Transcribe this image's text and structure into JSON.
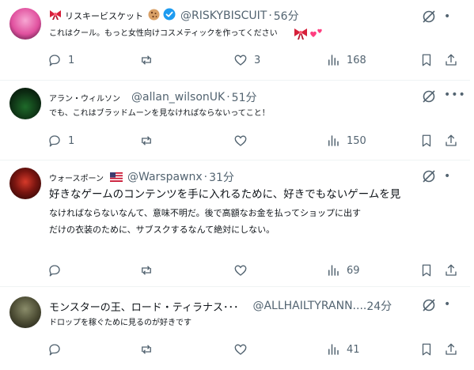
{
  "posts": [
    {
      "display_name": "リスキービスケット",
      "handle": "@RISKYBISCUIT",
      "time": "56分",
      "text_lines": [
        "これはクール。もっと女性向けコスメティックを作ってください"
      ],
      "replies": "1",
      "reposts": "",
      "likes": "3",
      "views": "168"
    },
    {
      "display_name": "アラン・ウィルソン",
      "handle": "@allan_wilsonUK",
      "time": "51分",
      "text_lines": [
        "でも、これはブラッドムーンを見なければならないってこと！"
      ],
      "replies": "1",
      "reposts": "",
      "likes": "",
      "views": "150"
    },
    {
      "display_name": "ウォースポーン",
      "handle": "@Warspawnx",
      "time": "31分",
      "text_lines": [
        "好きなゲームのコンテンツを手に入れるために、好きでもないゲームを見",
        "なければならないなんて、意味不明だ。後で高額なお金を払ってショップに出す",
        "だけの衣装のために、サブスクするなんて絶対にしない。"
      ],
      "replies": "",
      "reposts": "",
      "likes": "",
      "views": "69"
    },
    {
      "display_name": "モンスターの王、ロード・ティラナス･･･",
      "handle": "@ALLHAILTYRANN....",
      "time": "24分",
      "text_lines": [
        "ドロップを稼ぐために見るのが好きです"
      ],
      "replies": "",
      "reposts": "",
      "likes": "",
      "views": "41"
    }
  ],
  "colors": {
    "text": "#0f1419",
    "muted": "#536471",
    "verified": "#1d9bf0",
    "divider": "#eff3f4"
  }
}
